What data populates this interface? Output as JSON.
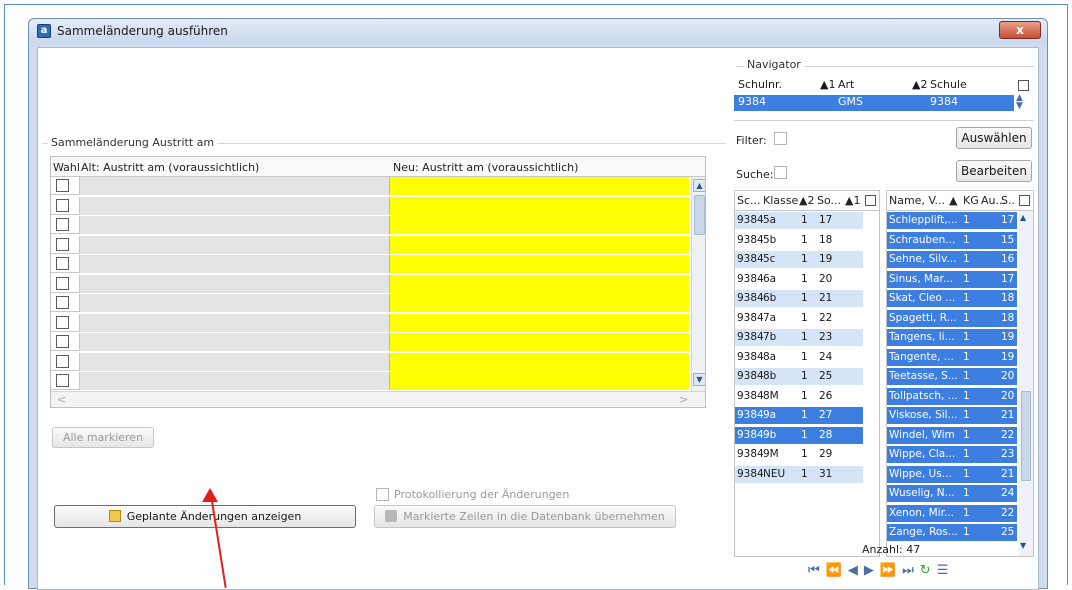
{
  "window": {
    "title": "Sammeländerung ausführen",
    "close_label": "x"
  },
  "group": {
    "label": "Sammeländerung Austritt am"
  },
  "grid": {
    "col_wahl": "Wahl",
    "col_alt": "Alt: Austritt am (voraussichtlich)",
    "col_neu": "Neu: Austritt am (voraussichtlich)",
    "row_count": 11
  },
  "buttons": {
    "mark_all": "Alle markieren",
    "show_changes": "Geplante Änderungen anzeigen",
    "apply": "Markierte Zeilen in die Datenbank übernehmen",
    "auswaehlen": "Auswählen",
    "bearbeiten": "Bearbeiten"
  },
  "protocol": {
    "label": "Protokollierung der Änderungen"
  },
  "navigator": {
    "title": "Navigator",
    "headers": {
      "schulnr": "Schulnr.",
      "art_sort": "▲1",
      "art": "Art",
      "schule_sort": "▲2",
      "schule": "Schule"
    },
    "row": {
      "schulnr": "9384",
      "art": "GMS",
      "schule": "9384"
    },
    "filter_label": "Filter:",
    "suche_label": "Suche:"
  },
  "classes": {
    "headers": {
      "sc": "Sc...",
      "klasse": "Klasse",
      "sort2": "▲2",
      "so": "So...",
      "sort1": "▲1"
    },
    "rows": [
      {
        "sc": "9384",
        "klasse": "5a",
        "n": "1",
        "so": "17",
        "state": "alt"
      },
      {
        "sc": "9384",
        "klasse": "5b",
        "n": "1",
        "so": "18",
        "state": ""
      },
      {
        "sc": "9384",
        "klasse": "5c",
        "n": "1",
        "so": "19",
        "state": "alt"
      },
      {
        "sc": "9384",
        "klasse": "6a",
        "n": "1",
        "so": "20",
        "state": ""
      },
      {
        "sc": "9384",
        "klasse": "6b",
        "n": "1",
        "so": "21",
        "state": "alt"
      },
      {
        "sc": "9384",
        "klasse": "7a",
        "n": "1",
        "so": "22",
        "state": ""
      },
      {
        "sc": "9384",
        "klasse": "7b",
        "n": "1",
        "so": "23",
        "state": "alt"
      },
      {
        "sc": "9384",
        "klasse": "8a",
        "n": "1",
        "so": "24",
        "state": ""
      },
      {
        "sc": "9384",
        "klasse": "8b",
        "n": "1",
        "so": "25",
        "state": "alt"
      },
      {
        "sc": "9384",
        "klasse": "8M",
        "n": "1",
        "so": "26",
        "state": ""
      },
      {
        "sc": "9384",
        "klasse": "9a",
        "n": "1",
        "so": "27",
        "state": "sel"
      },
      {
        "sc": "9384",
        "klasse": "9b",
        "n": "1",
        "so": "28",
        "state": "sel"
      },
      {
        "sc": "9384",
        "klasse": "9M",
        "n": "1",
        "so": "29",
        "state": ""
      },
      {
        "sc": "9384",
        "klasse": "NEU",
        "n": "1",
        "so": "31",
        "state": "alt"
      }
    ]
  },
  "students": {
    "headers": {
      "name": "Name, V...",
      "sort": "▲",
      "kg": "KG",
      "au": "Au...",
      "s": "S.."
    },
    "rows": [
      {
        "name": "Schlepplift,...",
        "kg": "1",
        "s": "17"
      },
      {
        "name": "Schrauben...",
        "kg": "1",
        "s": "15"
      },
      {
        "name": "Sehne, Silv...",
        "kg": "1",
        "s": "16"
      },
      {
        "name": "Sinus, Mar...",
        "kg": "1",
        "s": "17"
      },
      {
        "name": "Skat, Cleo ...",
        "kg": "1",
        "s": "18"
      },
      {
        "name": "Spagetti, R...",
        "kg": "1",
        "s": "18"
      },
      {
        "name": "Tangens, li...",
        "kg": "1",
        "s": "19"
      },
      {
        "name": "Tangente, ...",
        "kg": "1",
        "s": "19"
      },
      {
        "name": "Teetasse, S...",
        "kg": "1",
        "s": "20"
      },
      {
        "name": "Tollpatsch, ...",
        "kg": "1",
        "s": "20"
      },
      {
        "name": "Viskose, Sil...",
        "kg": "1",
        "s": "21"
      },
      {
        "name": "Windel, Wim",
        "kg": "1",
        "s": "22"
      },
      {
        "name": "Wippe, Cla...",
        "kg": "1",
        "s": "23"
      },
      {
        "name": "Wippe, Us...",
        "kg": "1",
        "s": "21"
      },
      {
        "name": "Wuselig, N...",
        "kg": "1",
        "s": "24"
      },
      {
        "name": "Xenon, Mir...",
        "kg": "1",
        "s": "22"
      },
      {
        "name": "Zange, Ros...",
        "kg": "1",
        "s": "25"
      }
    ],
    "count_label": "Anzahl: 47"
  },
  "colors": {
    "selection": "#3d7fe0",
    "new_value": "#ffff00",
    "arrow": "#e0201a"
  }
}
